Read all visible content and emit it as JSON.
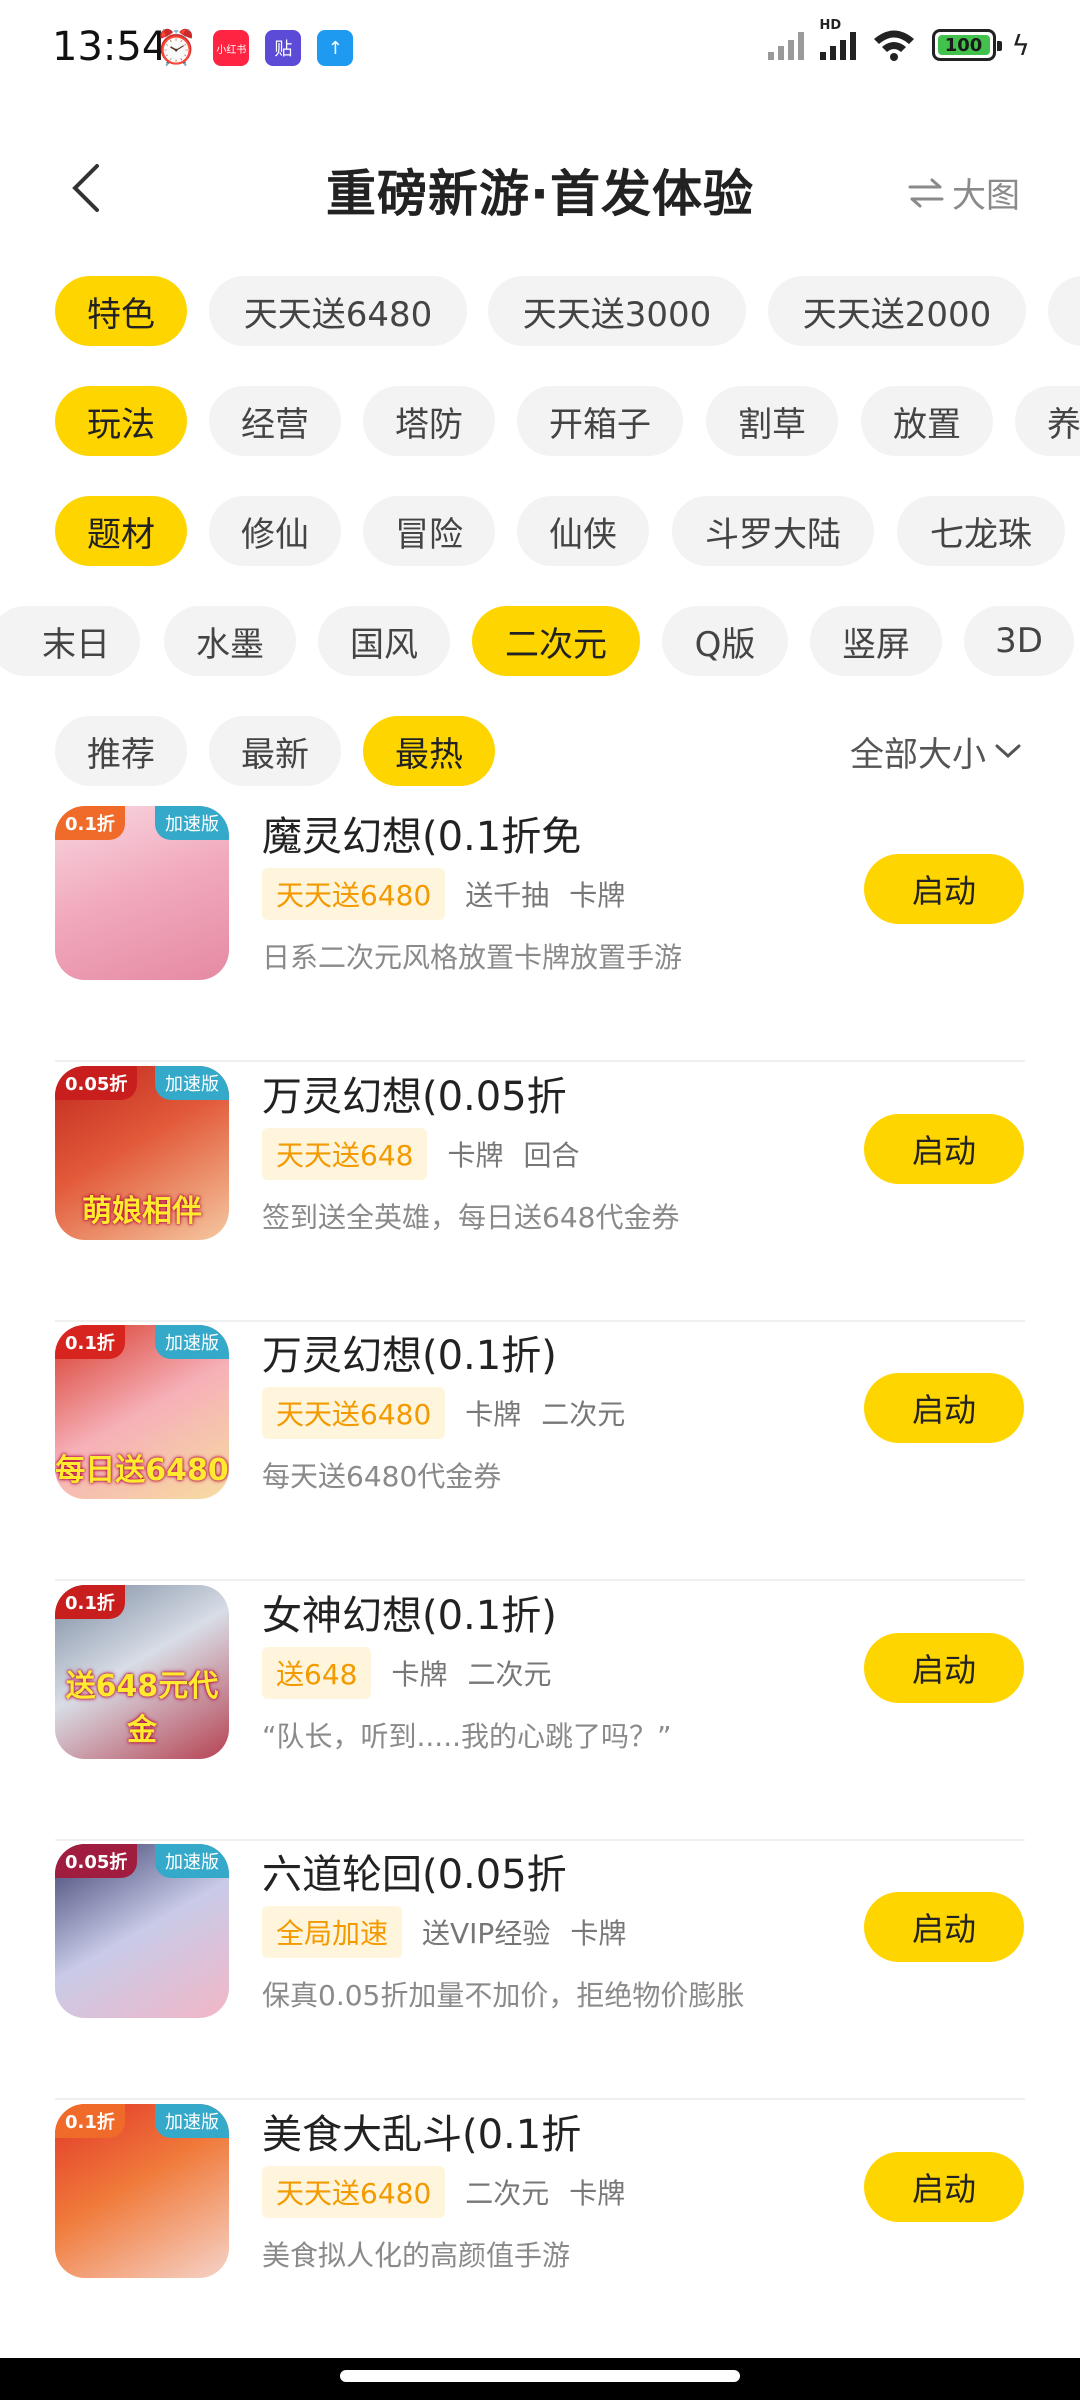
{
  "status_bar": {
    "time": "13:54",
    "apps": [
      {
        "name": "alarm-icon",
        "label": "⏰",
        "color": "#111111"
      },
      {
        "name": "xiaohongshu-app-icon",
        "label": "小红书",
        "color": "#ff2442"
      },
      {
        "name": "tieba-app-icon",
        "label": "贴",
        "color": "#5b4bd6"
      },
      {
        "name": "upload-app-icon",
        "label": "↑",
        "color": "#1e9bf0"
      }
    ],
    "network": "HD",
    "battery": "100"
  },
  "header": {
    "title": "重磅新游·首发体验",
    "view_toggle_label": "大图"
  },
  "filters": {
    "feature": {
      "label": "特色",
      "items": [
        "天天送6480",
        "天天送3000",
        "天天送2000"
      ]
    },
    "gameplay": {
      "label": "玩法",
      "items": [
        "经营",
        "塔防",
        "开箱子",
        "割草",
        "放置",
        "养"
      ]
    },
    "theme": {
      "label": "题材",
      "items": [
        "修仙",
        "冒险",
        "仙侠",
        "斗罗大陆",
        "七龙珠"
      ]
    },
    "style": {
      "items": [
        "末日",
        "水墨",
        "国风",
        "二次元",
        "Q版",
        "竖屏",
        "3D"
      ],
      "selected": "二次元"
    },
    "sort": {
      "items": [
        "推荐",
        "最新",
        "最热"
      ],
      "selected": "最热"
    },
    "size_label": "全部大小"
  },
  "games": [
    {
      "name": "魔灵幻想(0.1折免",
      "discount": "0.1折",
      "speed": "加速版",
      "caption": "",
      "highlight": "天天送6480",
      "tag1": "送千抽",
      "tag2": "卡牌",
      "desc": "日系二次元风格放置卡牌放置手游",
      "action": "启动"
    },
    {
      "name": "万灵幻想(0.05折",
      "discount": "0.05折",
      "speed": "加速版",
      "caption": "萌娘相伴",
      "highlight": "天天送648",
      "tag1": "卡牌",
      "tag2": "回合",
      "desc": "签到送全英雄，每日送648代金券",
      "action": "启动"
    },
    {
      "name": "万灵幻想(0.1折)",
      "discount": "0.1折",
      "speed": "加速版",
      "caption": "每日送6480",
      "highlight": "天天送6480",
      "tag1": "卡牌",
      "tag2": "二次元",
      "desc": "每天送6480代金券",
      "action": "启动"
    },
    {
      "name": "女神幻想(0.1折)",
      "discount": "0.1折",
      "speed": "",
      "caption": "送648元代金",
      "highlight": "送648",
      "tag1": "卡牌",
      "tag2": "二次元",
      "desc": "“队长，听到.....我的心跳了吗？”",
      "action": "启动"
    },
    {
      "name": "六道轮回(0.05折",
      "discount": "0.05折",
      "speed": "加速版",
      "caption": "",
      "highlight": "全局加速",
      "tag1": "送VIP经验",
      "tag2": "卡牌",
      "desc": "保真0.05折加量不加价，拒绝物价膨胀",
      "action": "启动"
    },
    {
      "name": "美食大乱斗(0.1折",
      "discount": "0.1折",
      "speed": "加速版",
      "caption": "",
      "highlight": "天天送6480",
      "tag1": "二次元",
      "tag2": "卡牌",
      "desc": "美食拟人化的高颜值手游",
      "action": "启动"
    }
  ],
  "colors": {
    "accent": "#ffd500",
    "highlight_text": "#f39a00",
    "highlight_bg": "#fff4dc"
  }
}
